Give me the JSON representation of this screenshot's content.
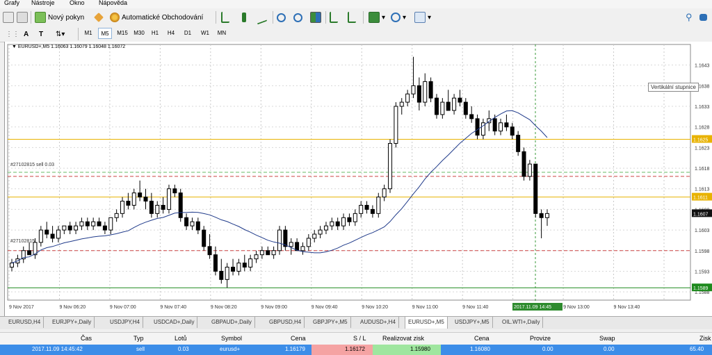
{
  "menu": {
    "items": [
      "Grafy",
      "Nástroje",
      "Okno",
      "Nápověda"
    ]
  },
  "toolbar": {
    "new_order": "Nový pokyn",
    "auto_trading": "Automatické Obchodování"
  },
  "timeframes": [
    "M1",
    "M5",
    "M15",
    "M30",
    "H1",
    "H4",
    "D1",
    "W1",
    "MN"
  ],
  "active_timeframe": "M5",
  "chart": {
    "header": "EURUSD+,M5  1.16063 1.16079 1.16048 1.16072",
    "tooltip": "Vertikální stupnice",
    "order_label_1": "#27102815 sell 0.03",
    "order_label_2": "#27102815",
    "date_tag": "2017.11.09 14:45"
  },
  "chart_data": {
    "type": "candlestick",
    "symbol": "EURUSD+",
    "timeframe": "M5",
    "price_axis_ticks": [
      "1.1643",
      "1.1638",
      "1.1633",
      "1.1628",
      "1.1623",
      "1.1618",
      "1.1613",
      "1.1608",
      "1.1603",
      "1.1598",
      "1.1593",
      "1.1588"
    ],
    "price_axis_labels_highlighted": [
      {
        "value": "1.1625",
        "color": "#e8b200"
      },
      {
        "value": "1.1611",
        "color": "#e8b200"
      },
      {
        "value": "1.1607",
        "color": "#111111"
      },
      {
        "value": "1.1589",
        "color": "#1e8a1e"
      }
    ],
    "time_axis_labels": [
      "9 Nov 2017",
      "9 Nov 06:20",
      "9 Nov 07:00",
      "9 Nov 07:40",
      "9 Nov 08:20",
      "9 Nov 09:00",
      "9 Nov 09:40",
      "9 Nov 10:20",
      "9 Nov 11:00",
      "9 Nov 11:40",
      "9 Nov 12:20",
      "9 Nov 13:00",
      "9 Nov 13:40",
      "9 Nov 14:45"
    ],
    "ylim": [
      1.1586,
      1.1648
    ],
    "horizontal_lines": [
      {
        "price": 1.1625,
        "color": "#e8b200",
        "style": "solid"
      },
      {
        "price": 1.1611,
        "color": "#e8b200",
        "style": "solid"
      },
      {
        "price": 1.1617,
        "color": "#66bb66",
        "style": "dashed"
      },
      {
        "price": 1.1616,
        "color": "#cc4444",
        "style": "dashed"
      },
      {
        "price": 1.1598,
        "color": "#cc4444",
        "style": "dashed"
      },
      {
        "price": 1.1589,
        "color": "#1e8a1e",
        "style": "solid"
      }
    ],
    "candles": [
      [
        1.1594,
        1.1596,
        1.1593,
        1.1595
      ],
      [
        1.1595,
        1.1597,
        1.1594,
        1.1596
      ],
      [
        1.1596,
        1.1599,
        1.1595,
        1.1598
      ],
      [
        1.1598,
        1.16,
        1.1597,
        1.1597
      ],
      [
        1.1597,
        1.1601,
        1.1596,
        1.16
      ],
      [
        1.16,
        1.1604,
        1.1599,
        1.1603
      ],
      [
        1.1603,
        1.1605,
        1.1601,
        1.1602
      ],
      [
        1.1602,
        1.1604,
        1.16,
        1.1601
      ],
      [
        1.1601,
        1.1604,
        1.16,
        1.1603
      ],
      [
        1.1603,
        1.1604,
        1.1602,
        1.1604
      ],
      [
        1.1604,
        1.1605,
        1.1602,
        1.1603
      ],
      [
        1.1603,
        1.1605,
        1.1602,
        1.1604
      ],
      [
        1.1604,
        1.1606,
        1.1603,
        1.1605
      ],
      [
        1.1605,
        1.1606,
        1.1603,
        1.1604
      ],
      [
        1.1604,
        1.1606,
        1.1603,
        1.1605
      ],
      [
        1.1605,
        1.1606,
        1.1604,
        1.1604
      ],
      [
        1.1604,
        1.1605,
        1.1602,
        1.1603
      ],
      [
        1.1603,
        1.1606,
        1.1602,
        1.1606
      ],
      [
        1.1606,
        1.1608,
        1.1605,
        1.1607
      ],
      [
        1.1607,
        1.1611,
        1.1606,
        1.161
      ],
      [
        1.161,
        1.1612,
        1.1608,
        1.1609
      ],
      [
        1.1609,
        1.1613,
        1.1608,
        1.1612
      ],
      [
        1.1612,
        1.1615,
        1.161,
        1.1611
      ],
      [
        1.1611,
        1.1613,
        1.1608,
        1.161
      ],
      [
        1.161,
        1.1612,
        1.1606,
        1.1607
      ],
      [
        1.1607,
        1.161,
        1.1606,
        1.1609
      ],
      [
        1.1609,
        1.1611,
        1.1607,
        1.1608
      ],
      [
        1.1608,
        1.1614,
        1.1607,
        1.1613
      ],
      [
        1.1613,
        1.1614,
        1.1611,
        1.1612
      ],
      [
        1.1612,
        1.1613,
        1.1605,
        1.1606
      ],
      [
        1.1606,
        1.1607,
        1.1603,
        1.1604
      ],
      [
        1.1604,
        1.1606,
        1.1603,
        1.1605
      ],
      [
        1.1605,
        1.1606,
        1.1602,
        1.1603
      ],
      [
        1.1603,
        1.1604,
        1.1598,
        1.1599
      ],
      [
        1.1599,
        1.1602,
        1.1596,
        1.1597
      ],
      [
        1.1597,
        1.1599,
        1.1592,
        1.1593
      ],
      [
        1.1593,
        1.1596,
        1.159,
        1.1591
      ],
      [
        1.1591,
        1.1595,
        1.1589,
        1.1594
      ],
      [
        1.1594,
        1.1596,
        1.1592,
        1.1593
      ],
      [
        1.1593,
        1.1596,
        1.1592,
        1.1595
      ],
      [
        1.1595,
        1.1597,
        1.1593,
        1.1594
      ],
      [
        1.1594,
        1.1597,
        1.1593,
        1.1596
      ],
      [
        1.1596,
        1.1598,
        1.1595,
        1.1597
      ],
      [
        1.1597,
        1.1599,
        1.1596,
        1.1598
      ],
      [
        1.1598,
        1.1599,
        1.1597,
        1.1597
      ],
      [
        1.1597,
        1.1599,
        1.1596,
        1.1598
      ],
      [
        1.1598,
        1.1604,
        1.1597,
        1.1603
      ],
      [
        1.1603,
        1.1604,
        1.1598,
        1.1599
      ],
      [
        1.1599,
        1.1601,
        1.1597,
        1.16
      ],
      [
        1.16,
        1.1601,
        1.1598,
        1.1598
      ],
      [
        1.1598,
        1.16,
        1.1597,
        1.1599
      ],
      [
        1.1599,
        1.1602,
        1.1598,
        1.1601
      ],
      [
        1.1601,
        1.1603,
        1.16,
        1.1602
      ],
      [
        1.1602,
        1.1604,
        1.1601,
        1.1603
      ],
      [
        1.1603,
        1.1605,
        1.1602,
        1.1604
      ],
      [
        1.1604,
        1.1606,
        1.1603,
        1.1605
      ],
      [
        1.1605,
        1.1606,
        1.1603,
        1.1604
      ],
      [
        1.1604,
        1.1607,
        1.1603,
        1.1606
      ],
      [
        1.1606,
        1.1607,
        1.1604,
        1.1605
      ],
      [
        1.1605,
        1.1608,
        1.1604,
        1.1607
      ],
      [
        1.1607,
        1.161,
        1.1606,
        1.1609
      ],
      [
        1.1609,
        1.161,
        1.1607,
        1.1608
      ],
      [
        1.1608,
        1.1609,
        1.1606,
        1.1607
      ],
      [
        1.1607,
        1.1612,
        1.1606,
        1.1611
      ],
      [
        1.1611,
        1.1614,
        1.161,
        1.1613
      ],
      [
        1.1613,
        1.1625,
        1.1612,
        1.1624
      ],
      [
        1.1624,
        1.1634,
        1.1623,
        1.1633
      ],
      [
        1.1633,
        1.1635,
        1.1631,
        1.1634
      ],
      [
        1.1634,
        1.1637,
        1.1633,
        1.1636
      ],
      [
        1.1636,
        1.1645,
        1.1635,
        1.1638
      ],
      [
        1.1638,
        1.164,
        1.1632,
        1.1634
      ],
      [
        1.1634,
        1.1641,
        1.1633,
        1.1639
      ],
      [
        1.1639,
        1.164,
        1.1634,
        1.1635
      ],
      [
        1.1635,
        1.1636,
        1.163,
        1.1631
      ],
      [
        1.1631,
        1.1635,
        1.163,
        1.1634
      ],
      [
        1.1634,
        1.1637,
        1.1632,
        1.1632
      ],
      [
        1.1632,
        1.1636,
        1.1631,
        1.1635
      ],
      [
        1.1635,
        1.1637,
        1.1633,
        1.1634
      ],
      [
        1.1634,
        1.1635,
        1.163,
        1.1631
      ],
      [
        1.1631,
        1.1633,
        1.1629,
        1.163
      ],
      [
        1.163,
        1.1631,
        1.1625,
        1.1626
      ],
      [
        1.1626,
        1.163,
        1.1625,
        1.1629
      ],
      [
        1.1629,
        1.1632,
        1.1627,
        1.163
      ],
      [
        1.163,
        1.1631,
        1.1626,
        1.1627
      ],
      [
        1.1627,
        1.163,
        1.1626,
        1.1629
      ],
      [
        1.1629,
        1.1631,
        1.1627,
        1.1628
      ],
      [
        1.1628,
        1.1629,
        1.1625,
        1.1626
      ],
      [
        1.1626,
        1.1627,
        1.1621,
        1.1622
      ],
      [
        1.1622,
        1.1623,
        1.1615,
        1.1616
      ],
      [
        1.1616,
        1.162,
        1.1615,
        1.1619
      ],
      [
        1.1619,
        1.1619,
        1.1606,
        1.1607
      ],
      [
        1.1607,
        1.1608,
        1.1601,
        1.1606
      ],
      [
        1.1606,
        1.1608,
        1.1604,
        1.1607
      ]
    ],
    "moving_average_color": "#1f3a8a"
  },
  "tabs": [
    "EURUSD,H4",
    "EURJPY+,Daily",
    "USDJPY,H4",
    "USDCAD+,Daily",
    "GBPAUD+,Daily",
    "GBPUSD,H4",
    "GBPJPY+,M5",
    "AUDUSD+,H4",
    "EURUSD+,M5",
    "USDJPY+,M5",
    "OIL.WTI+,Daily"
  ],
  "active_tab": "EURUSD+,M5",
  "terminal": {
    "headers": [
      "Čas",
      "Typ",
      "Lotů",
      "Symbol",
      "Cena",
      "S / L",
      "Realizovat zisk",
      "Cena",
      "Provize",
      "Swap",
      "Zisk"
    ],
    "row": [
      "2017.11.09 14:45:42",
      "sell",
      "0.03",
      "eurusd+",
      "1.16179",
      "1.16172",
      "1.15980",
      "1.16080",
      "0.00",
      "0.00",
      "65.40"
    ]
  },
  "colors": {
    "sl_cell": "#f5a3a3",
    "tp_cell": "#9fe69f",
    "row_selected": "#3c8de8"
  }
}
